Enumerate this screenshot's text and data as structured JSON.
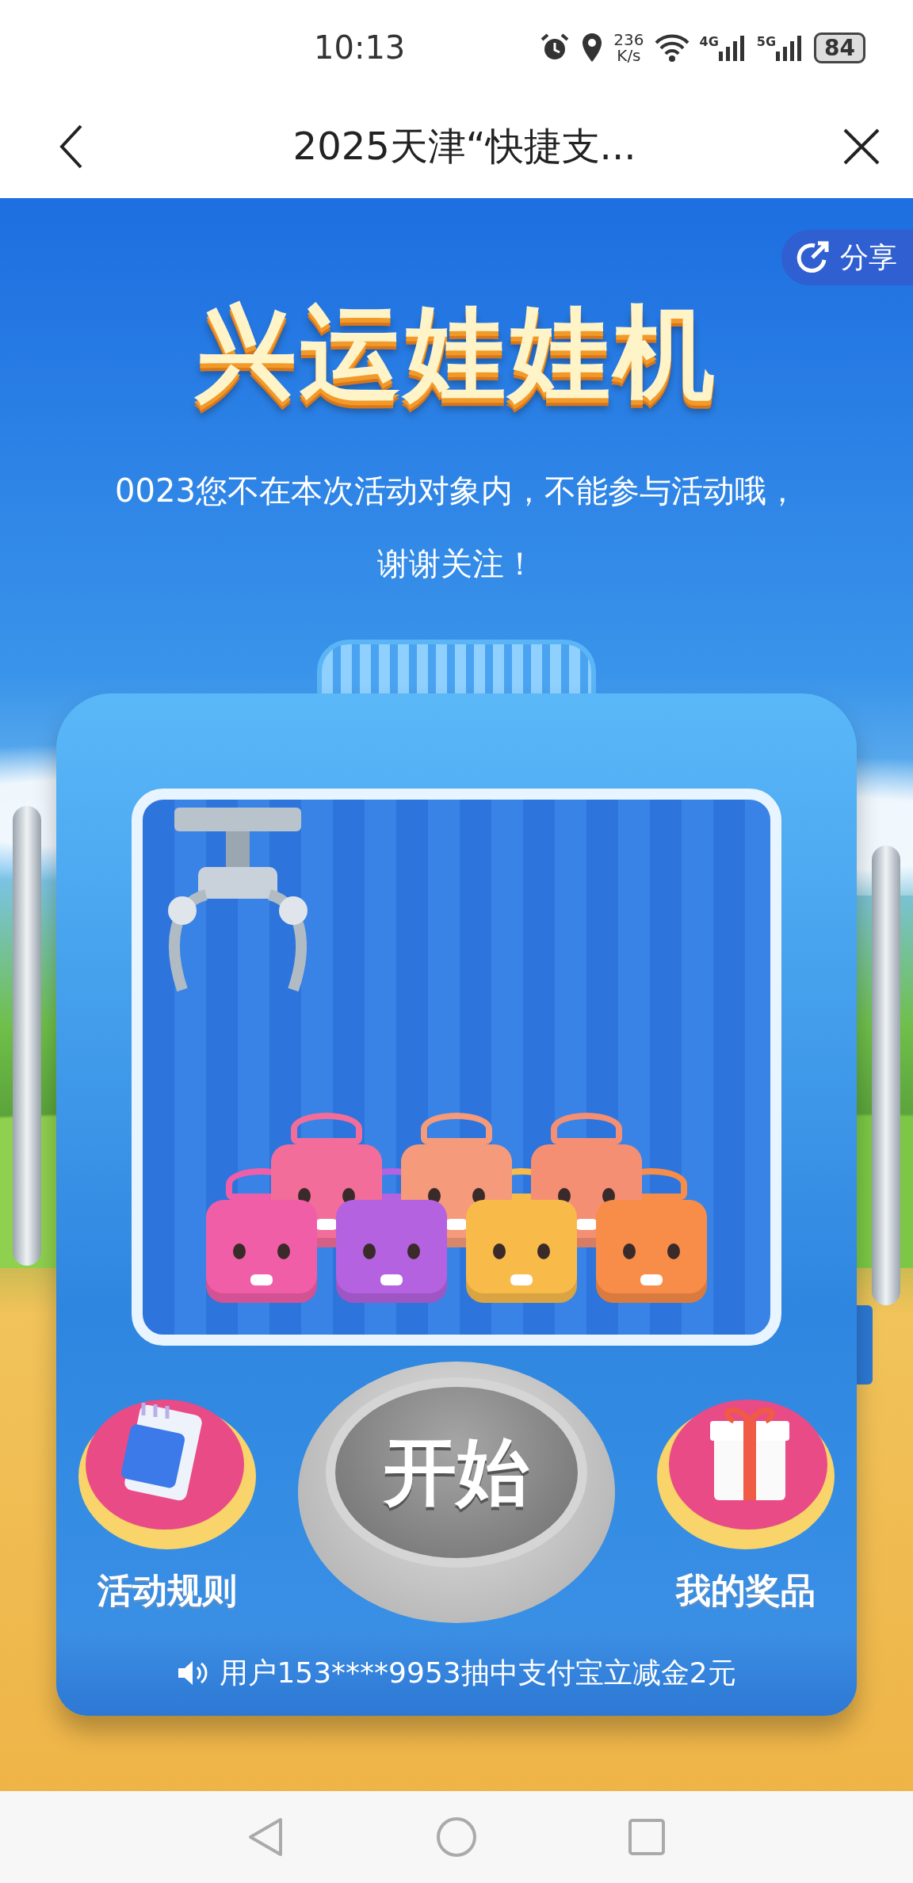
{
  "status_bar": {
    "time": "10:13",
    "speed_value": "236",
    "speed_unit": "K/s",
    "signal_a_label": "4G",
    "signal_b_label": "5G",
    "battery": "84"
  },
  "nav_bar": {
    "title": "2025天津“快捷支..."
  },
  "share_button": {
    "label": "分享"
  },
  "title": "兴运娃娃机",
  "message": "0023您不在本次活动对象内，不能参与活动哦，谢谢关注！",
  "machine": {
    "start_button": {
      "label": "开始"
    },
    "side_buttons": [
      {
        "kind": "rules",
        "label": "活动规则"
      },
      {
        "kind": "prizes",
        "label": "我的奖品"
      }
    ],
    "ticker": "用户153****9953抽中支付宝立减金2元"
  }
}
